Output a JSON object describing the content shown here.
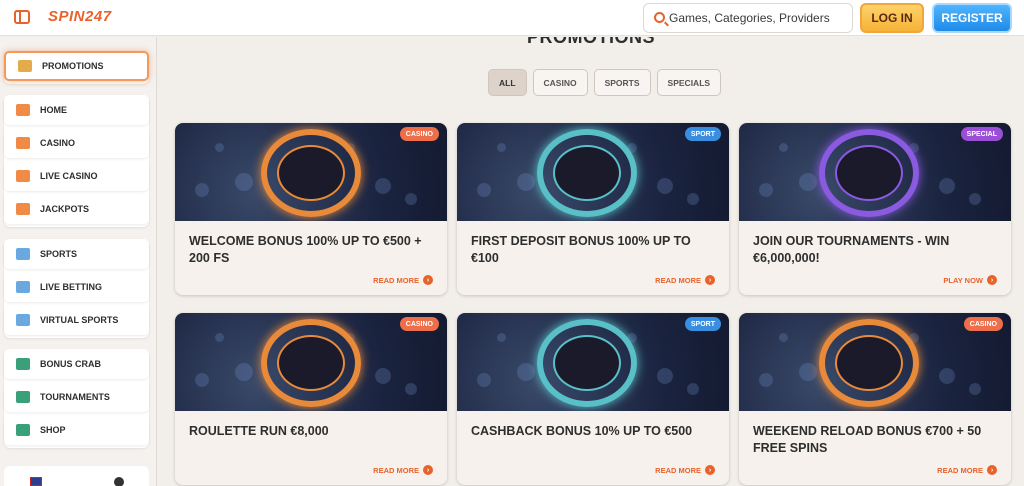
{
  "header": {
    "logo": "SPIN247",
    "search_placeholder": "Games, Categories, Providers",
    "login_label": "LOG IN",
    "register_label": "REGISTER"
  },
  "sidebar": {
    "groups": [
      [
        {
          "label": "PROMOTIONS",
          "icon": "gift-icon",
          "active": true
        }
      ],
      [
        {
          "label": "HOME",
          "icon": "home-icon"
        },
        {
          "label": "CASINO",
          "icon": "casino-icon"
        },
        {
          "label": "LIVE CASINO",
          "icon": "live-casino-icon"
        },
        {
          "label": "JACKPOTS",
          "icon": "jackpots-icon"
        }
      ],
      [
        {
          "label": "SPORTS",
          "icon": "sports-ball-icon"
        },
        {
          "label": "LIVE BETTING",
          "icon": "live-betting-icon"
        },
        {
          "label": "VIRTUAL SPORTS",
          "icon": "virtual-sports-icon"
        }
      ],
      [
        {
          "label": "BONUS CRAB",
          "icon": "crab-icon"
        },
        {
          "label": "TOURNAMENTS",
          "icon": "trophy-icon"
        },
        {
          "label": "SHOP",
          "icon": "shop-icon"
        }
      ]
    ]
  },
  "main": {
    "title": "PROMOTIONS",
    "filters": [
      {
        "label": "ALL",
        "active": true
      },
      {
        "label": "CASINO"
      },
      {
        "label": "SPORTS"
      },
      {
        "label": "SPECIALS"
      }
    ],
    "cards": [
      {
        "title": "WELCOME BONUS 100% UP TO €500 + 200 FS",
        "badge": "CASINO",
        "badge_color": "#ee6e4a",
        "link": "READ MORE",
        "emblem": "cherries-icon",
        "ring": "#e88a3a"
      },
      {
        "title": "FIRST DEPOSIT BONUS 100% UP TO €100",
        "badge": "SPORT",
        "badge_color": "#3a8ee0",
        "link": "READ MORE",
        "emblem": "soccer-ball-icon",
        "ring": "#5ac0c8"
      },
      {
        "title": "JOIN OUR TOURNAMENTS - WIN €6,000,000!",
        "badge": "SPECIAL",
        "badge_color": "#9b4fd6",
        "link": "PLAY NOW",
        "emblem": "checkered-flags-icon",
        "ring": "#8a5ae0"
      },
      {
        "title": "ROULETTE RUN €8,000",
        "badge": "CASINO",
        "badge_color": "#ee6e4a",
        "link": "READ MORE",
        "emblem": "roulette-icon",
        "ring": "#e88a3a"
      },
      {
        "title": "CASHBACK BONUS 10% UP TO €500",
        "badge": "SPORT",
        "badge_color": "#3a8ee0",
        "link": "READ MORE",
        "emblem": "cash-icon",
        "ring": "#5ac0c8"
      },
      {
        "title": "WEEKEND RELOAD BONUS €700 + 50 FREE SPINS",
        "badge": "CASINO",
        "badge_color": "#ee6e4a",
        "link": "READ MORE",
        "emblem": "poker-chip-icon",
        "ring": "#e88a3a"
      }
    ]
  }
}
